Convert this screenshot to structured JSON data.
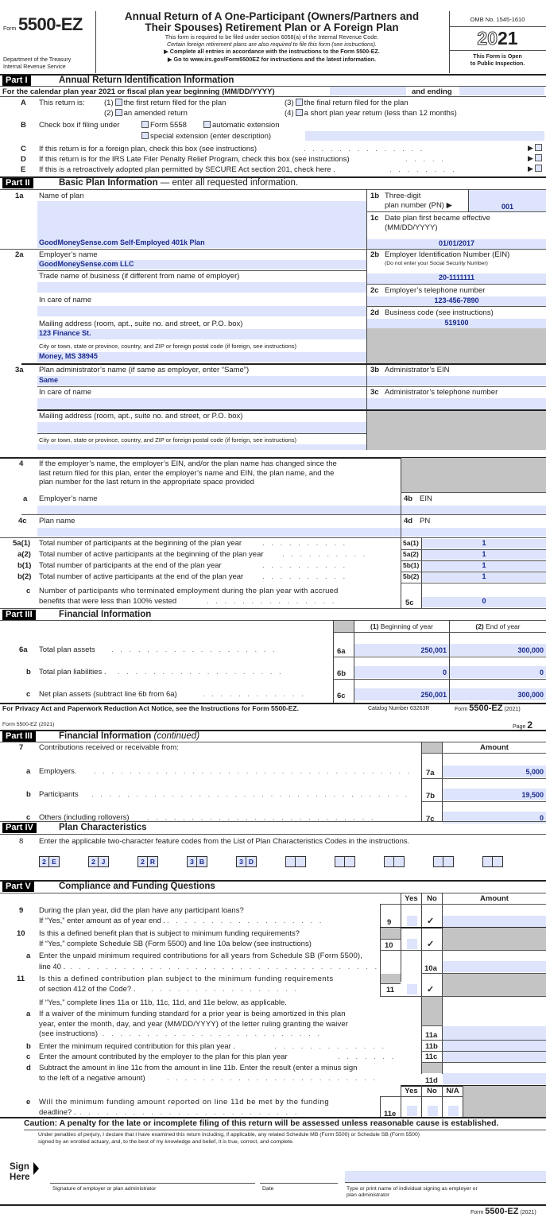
{
  "header": {
    "form_prefix": "Form",
    "form_number": "5500-EZ",
    "title_line1": "Annual Return of A One-Participant (Owners/Partners and",
    "title_line2": "Their Spouses) Retirement Plan or A Foreign Plan",
    "sub1": "This form is required to be filed under section 6058(a) of the Internal Revenue Code.",
    "sub2": "Certain foreign retirement plans are also required to file this form (see instructions).",
    "sub3": "▶ Complete all entries in accordance with the instructions to the Form 5500-EZ.",
    "sub4": "▶ Go to www.irs.gov/Form5500EZ for instructions and the latest information.",
    "dept1": "Department of the Treasury",
    "dept2": "Internal Revenue Service",
    "omb": "OMB No. 1545-1610",
    "year_outline": "20",
    "year_bold": "21",
    "public1": "This Form is Open",
    "public2": "to Public Inspection."
  },
  "part1": {
    "tag": "Part I",
    "title": "Annual Return Identification Information",
    "calendar": "For the calendar plan year 2021 or fiscal plan year beginning (MM/DD/YYYY)",
    "and_ending": "and ending",
    "begin_value": "",
    "end_value": "",
    "A": {
      "letter": "A",
      "label": "This return is:",
      "o1": "(1)",
      "t1": "the first return filed for the plan",
      "o2": "(2)",
      "t2": "an amended return",
      "o3": "(3)",
      "t3": "the final return filed for the plan",
      "o4": "(4)",
      "t4": "a short plan year return (less than 12 months)"
    },
    "B": {
      "letter": "B",
      "label": "Check box if filing under",
      "t1": "Form 5558",
      "t2": "automatic extension",
      "t3": "special extension (enter description)",
      "desc": ""
    },
    "C": {
      "letter": "C",
      "text": "If this return is for a foreign plan, check this box (see instructions)"
    },
    "D": {
      "letter": "D",
      "text": "If this return is for the IRS Late Filer Penalty Relief Program, check this box (see instructions)"
    },
    "E": {
      "letter": "E",
      "text": "If this is a retroactively adopted plan permitted by SECURE Act section 201, check here ."
    }
  },
  "part2": {
    "tag": "Part II",
    "title": "Basic Plan Information",
    "title_rest": " — enter all requested information.",
    "l1a": {
      "num": "1a",
      "label": "Name of plan",
      "value": "GoodMoneySense.com Self-Employed 401k Plan"
    },
    "l1b": {
      "num": "1b",
      "label1": "Three-digit",
      "label2": "plan number (PN) ▶",
      "value": "001"
    },
    "l1c": {
      "num": "1c",
      "label1": "Date plan first became effective",
      "label2": "(MM/DD/YYYY)",
      "value": "01/01/2017"
    },
    "l2a": {
      "num": "2a",
      "label": "Employer’s name",
      "value": "GoodMoneySense.com LLC",
      "trade": "Trade name of business (if different from name of employer)",
      "trade_value": "",
      "care": "In care of name",
      "care_value": "",
      "mail": "Mailing address (room, apt., suite no. and street, or P.O. box)",
      "mail_value": "123 Finance St.",
      "city": "City or town, state or province, country, and ZIP or foreign postal code (if foreign, see instructions)",
      "city_value": "Money, MS 38945"
    },
    "l2b": {
      "num": "2b",
      "label": "Employer Identification Number (EIN)",
      "note": "(Do not enter your Social Security Number)",
      "value": "20-1111111"
    },
    "l2c": {
      "num": "2c",
      "label": "Employer’s telephone number",
      "value": "123-456-7890"
    },
    "l2d": {
      "num": "2d",
      "label": "Business code (see instructions)",
      "value": "519100"
    },
    "l3a": {
      "num": "3a",
      "label": "Plan administrator’s name (if same as employer, enter “Same”)",
      "value": "Same",
      "care": "In care of name",
      "mail": "Mailing address (room, apt., suite no. and street, or P.O. box)",
      "city": "City or town, state or province, country, and ZIP or foreign postal code (if foreign, see instructions)"
    },
    "l3b": {
      "num": "3b",
      "label": "Administrator’s EIN",
      "value": ""
    },
    "l3c": {
      "num": "3c",
      "label": "Administrator’s telephone number",
      "value": ""
    },
    "l4": {
      "num": "4",
      "text1": "If the employer’s name, the employer’s EIN, and/or the plan name has changed since the",
      "text2": "last return filed for this plan, enter the employer’s name and EIN, the plan name, and the",
      "text3": "plan number for the last return in the appropriate space provided",
      "a_num": "a",
      "a_label": "Employer’s name",
      "b_num": "4b",
      "b_label": "EIN",
      "c_num": "4c",
      "c_label": "Plan name",
      "d_num": "4d",
      "d_label": "PN"
    },
    "l5": [
      {
        "num": "5a(1)",
        "text": "Total number of participants at the beginning of the plan year",
        "box": "5a(1)",
        "value": "1"
      },
      {
        "num": "a(2)",
        "text": "Total number of active participants at the beginning of the plan year",
        "box": "5a(2)",
        "value": "1"
      },
      {
        "num": "b(1)",
        "text": "Total number of participants at the end of the plan year",
        "box": "5b(1)",
        "value": "1"
      },
      {
        "num": "b(2)",
        "text": "Total number of active participants at the end of the plan year",
        "box": "5b(2)",
        "value": "1"
      }
    ],
    "l5c": {
      "num": "c",
      "text1": "Number of participants who terminated employment during the plan year with accrued",
      "text2": "benefits that were less than 100% vested",
      "box": "5c",
      "value": "0"
    }
  },
  "part3": {
    "tag": "Part III",
    "title": "Financial Information",
    "col1_num": "(1)",
    "col1": " Beginning of year",
    "col2_num": "(2)",
    "col2": " End of year",
    "rows": [
      {
        "num": "6a",
        "text": "Total plan assets",
        "box": "6a",
        "begin": "250,001",
        "end": "300,000"
      },
      {
        "num": "b",
        "text": "Total plan liabilities .",
        "box": "6b",
        "begin": "0",
        "end": "0"
      },
      {
        "num": "c",
        "text": "Net plan assets (subtract line 6b from 6a)",
        "box": "6c",
        "begin": "250,001",
        "end": "300,000"
      }
    ]
  },
  "footer1": {
    "privacy": "For Privacy Act and Paperwork Reduction Act Notice, see the Instructions for Form 5500-EZ.",
    "catalog": "Catalog Number 63263R",
    "form": "Form",
    "form_num": "5500-EZ",
    "year": "(2021)"
  },
  "page2": {
    "header_left": "Form 5500-EZ (2021)",
    "page_label": "Page",
    "page_num": "2"
  },
  "part3b": {
    "tag": "Part III",
    "title": "Financial Information",
    "title_cont": " (continued)",
    "l7_num": "7",
    "l7_text": "Contributions received or receivable from:",
    "amount": "Amount",
    "rows": [
      {
        "num": "a",
        "text": "Employers.",
        "box": "7a",
        "value": "5,000"
      },
      {
        "num": "b",
        "text": "Participants",
        "box": "7b",
        "value": "19,500"
      },
      {
        "num": "c",
        "text": "Others (including rollovers)",
        "box": "7c",
        "value": "0"
      }
    ]
  },
  "part4": {
    "tag": "Part IV",
    "title": "Plan Characteristics",
    "l8_num": "8",
    "l8_text": "Enter the applicable two-character feature codes from the List of Plan Characteristics Codes in the instructions.",
    "codes": [
      [
        "2",
        "E"
      ],
      [
        "2",
        "J"
      ],
      [
        "2",
        "R"
      ],
      [
        "3",
        "B"
      ],
      [
        "3",
        "D"
      ],
      [
        "",
        ""
      ],
      [
        "",
        ""
      ],
      [
        "",
        ""
      ],
      [
        "",
        ""
      ],
      [
        "",
        ""
      ]
    ]
  },
  "part5": {
    "tag": "Part V",
    "title": "Compliance and Funding Questions",
    "yes": "Yes",
    "no": "No",
    "na": "N/A",
    "amount": "Amount",
    "check": "✓",
    "l9": {
      "num": "9",
      "t1": "During the plan year, did the plan have any participant loans?",
      "t2": "If “Yes,” enter amount as of year end .",
      "box": "9"
    },
    "l10": {
      "num": "10",
      "t1": "Is this a defined benefit plan that is subject to minimum funding requirements?",
      "t2": "If “Yes,” complete Schedule SB (Form 5500) and line 10a below (see instructions)",
      "box": "10"
    },
    "l10a": {
      "num": "a",
      "t1": "Enter the unpaid minimum required contributions for all years from Schedule SB (Form 5500),",
      "t2": "line 40 .",
      "box": "10a"
    },
    "l11": {
      "num": "11",
      "t1": "Is this a defined contribution plan subject to the minimum funding requirements",
      "t2": "of section 412 of the Code? .",
      "box": "11",
      "t3": "If “Yes,” complete lines 11a or 11b, 11c, 11d, and 11e below, as applicable."
    },
    "l11a": {
      "num": "a",
      "t1": "If a waiver of the minimum funding standard for a prior year is being amortized in this plan",
      "t2": "year, enter the month, day, and year (MM/DD/YYYY) of the letter ruling granting the waiver",
      "t3": "(see instructions)",
      "box": "11a"
    },
    "l11b": {
      "num": "b",
      "t1": "Enter the minimum required contribution for this plan year .",
      "box": "11b"
    },
    "l11c": {
      "num": "c",
      "t1": "Enter the amount contributed by the employer to the plan for this plan year",
      "box": "11c"
    },
    "l11d": {
      "num": "d",
      "t1": "Subtract the amount in line 11c from the amount in line 11b. Enter the result (enter a minus sign",
      "t2": "to the left of a negative amount)",
      "box": "11d"
    },
    "l11e": {
      "num": "e",
      "t1": "Will the minimum funding amount reported on line 11d be met by the funding",
      "t2": "deadline? .",
      "box": "11e"
    }
  },
  "caution": "Caution: A penalty for the late or incomplete filing of this return will be assessed unless reasonable cause is established.",
  "perjury1": "Under penalties of perjury, I declare that I have examined this return including, if applicable, any related Schedule MB (Form 5500) or Schedule SB (Form 5500)",
  "perjury2": "signed by an enrolled actuary, and, to the best of my knowledge and belief, it is true, correct, and complete.",
  "sign": {
    "sign": "Sign",
    "here": "Here",
    "sig_label": "Signature of employer or plan administrator",
    "date_label": "Date",
    "name_label1": "Type or print name of individual signing as employer or",
    "name_label2": "plan administrator",
    "name_value": ""
  },
  "footer2": {
    "form": "Form",
    "form_num": "5500-EZ",
    "year": "(2021)"
  }
}
